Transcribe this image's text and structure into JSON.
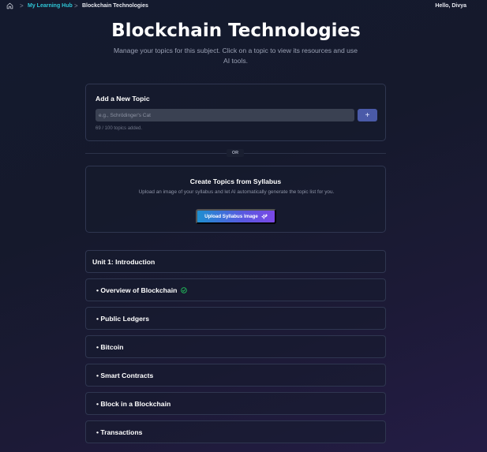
{
  "breadcrumb": {
    "home_icon": "home-icon",
    "separator": ">",
    "hub_label": "My Learning Hub",
    "current_label": "Blockchain Technologies"
  },
  "user": {
    "greeting": "Hello, Divya"
  },
  "header": {
    "title": "Blockchain Technologies",
    "subtitle": "Manage your topics for this subject. Click on a topic to view its resources and use AI tools."
  },
  "add_topic": {
    "title": "Add a New Topic",
    "input_placeholder": "e.g., Schrödinger's Cat",
    "input_value": "",
    "add_button_label": "+",
    "count_text": "69 / 100 topics added."
  },
  "divider": {
    "label": "OR"
  },
  "syllabus": {
    "title": "Create Topics from Syllabus",
    "description": "Upload an image of your syllabus and let AI automatically generate the topic list for you.",
    "upload_button_label": "Upload Syllabus Image",
    "upload_icon": "sparkle-icon"
  },
  "topics": {
    "unit": "Unit 1: Introduction",
    "items": [
      {
        "label": "• Overview of Blockchain",
        "completed": true
      },
      {
        "label": "• Public Ledgers",
        "completed": false
      },
      {
        "label": "• Bitcoin",
        "completed": false
      },
      {
        "label": "• Smart Contracts",
        "completed": false
      },
      {
        "label": "• Block in a Blockchain",
        "completed": false
      },
      {
        "label": "• Transactions",
        "completed": false
      }
    ]
  },
  "colors": {
    "accent_cyan": "#2ec6d6",
    "check_green": "#22c55e",
    "button_gradient_start": "#1e8fd0",
    "button_gradient_end": "#7a48e6"
  }
}
